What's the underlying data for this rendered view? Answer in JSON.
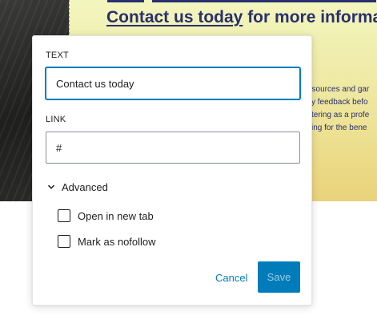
{
  "background": {
    "heading_link": "Contact us today",
    "heading_rest": " for more informat",
    "side_lines": [
      "esources and gar",
      "ity feedback befo",
      "stering as a profe",
      "sing for the bene"
    ]
  },
  "popover": {
    "text_label": "Text",
    "text_value": "Contact us today",
    "link_label": "Link",
    "link_value": "#",
    "advanced_label": "Advanced",
    "open_new_tab_label": "Open in new tab",
    "nofollow_label": "Mark as nofollow",
    "cancel_label": "Cancel",
    "save_label": "Save"
  },
  "colors": {
    "accent": "#007cba",
    "heading": "#2a2f6e"
  }
}
